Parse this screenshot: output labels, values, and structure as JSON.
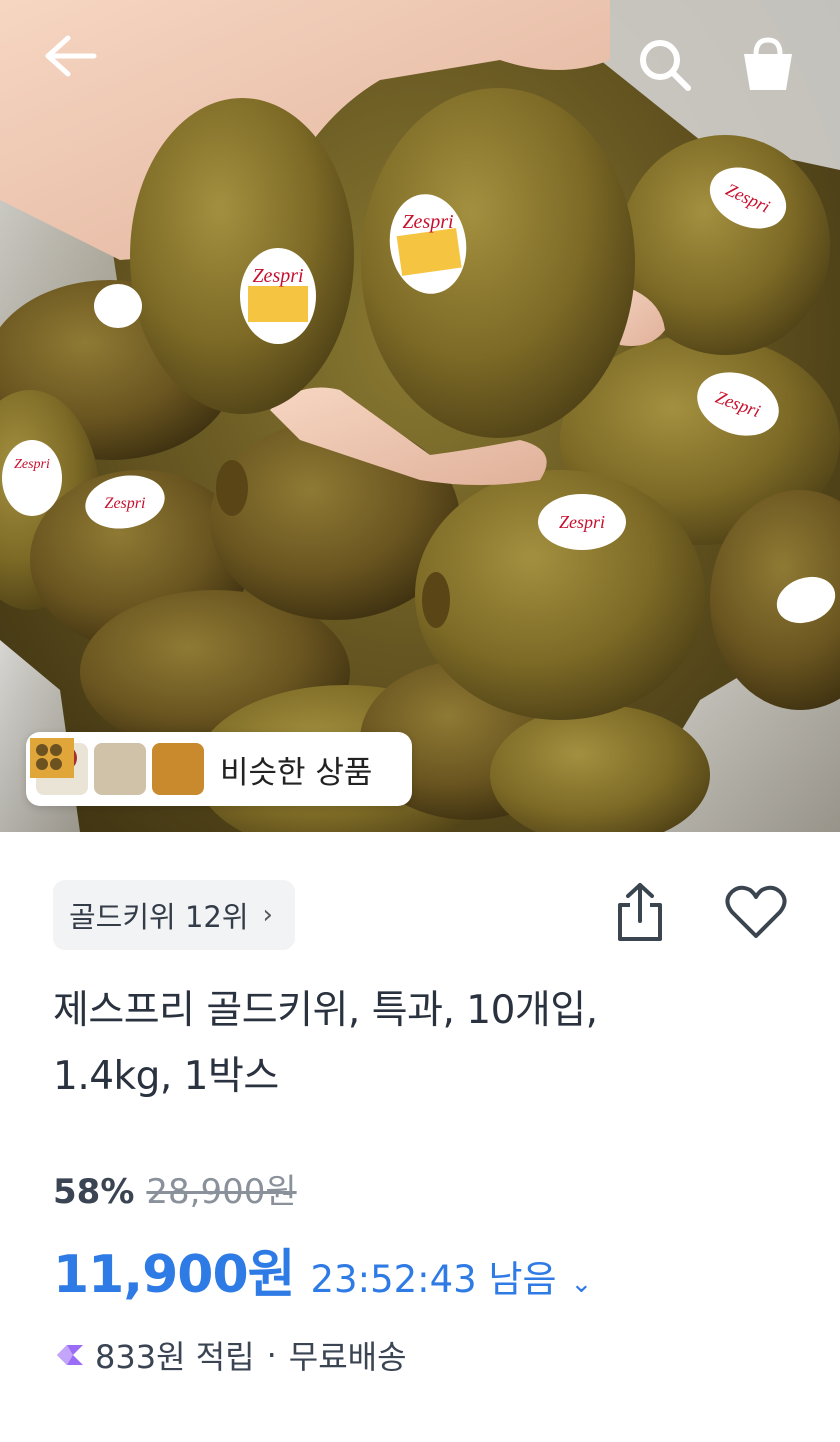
{
  "header": {
    "back_icon": "arrow-left-icon",
    "search_icon": "search-icon",
    "cart_icon": "shopping-bag-icon"
  },
  "hero": {
    "sticker_text": "Zespri",
    "similar_products_label": "비슷한 상품"
  },
  "ranking": {
    "label": "골드키위 12위",
    "chevron": "›"
  },
  "actions": {
    "share_icon": "share-icon",
    "wishlist_icon": "heart-icon"
  },
  "product": {
    "title_line1": "제스프리 골드키위, 특과, 10개입,",
    "title_line2": "1.4kg, 1박스"
  },
  "pricing": {
    "discount": "58%",
    "original_price": "28,900원",
    "sale_price": "11,900원",
    "time_left": "23:52:43 남음",
    "expand": "⌄"
  },
  "benefits": {
    "reward_text": "833원 적립",
    "separator": "·",
    "shipping_text": "무료배송"
  },
  "colors": {
    "price_blue": "#2f7be5",
    "text_dark": "#29323e",
    "chip_bg": "#f2f3f5",
    "reward_purple": "#9b6cf5"
  }
}
